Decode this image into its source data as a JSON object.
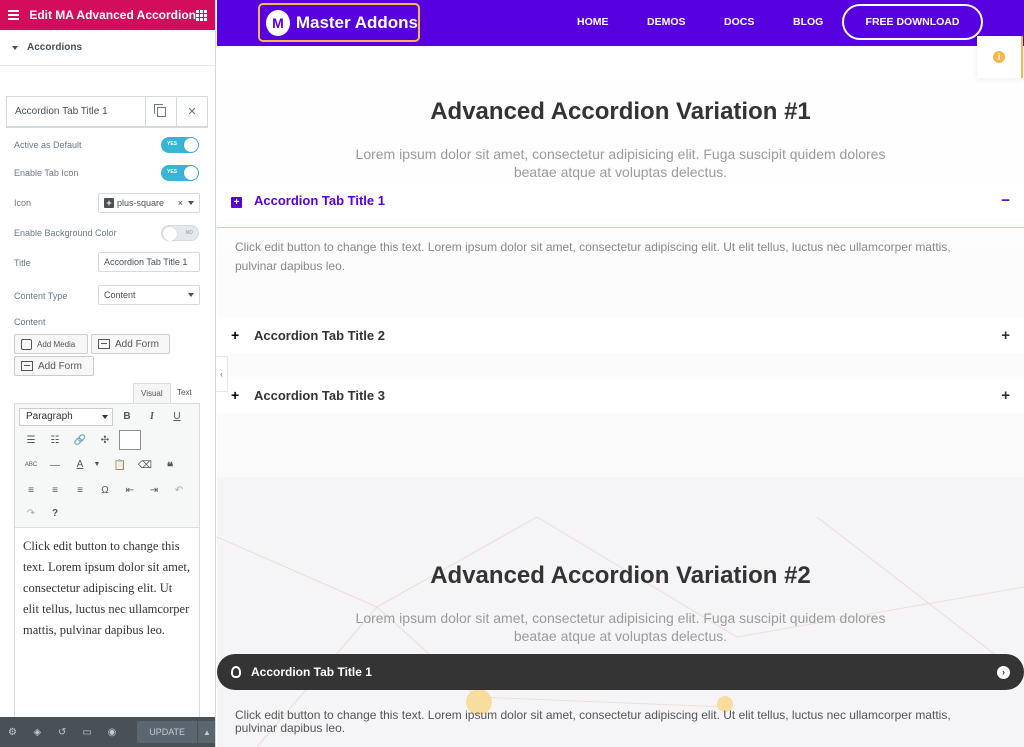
{
  "editor_panel": {
    "title": "Edit MA Advanced Accordion",
    "section": "Accordions",
    "repeater_item": {
      "title": "Accordion Tab Title 1"
    },
    "controls": {
      "active_default": {
        "label": "Active as Default",
        "state": "YES"
      },
      "enable_tab_icon": {
        "label": "Enable Tab Icon",
        "state": "YES"
      },
      "icon": {
        "label": "Icon",
        "value": "plus-square",
        "clear": "×"
      },
      "enable_bg_color": {
        "label": "Enable Background Color",
        "state": "NO"
      },
      "title": {
        "label": "Title",
        "value": "Accordion Tab Title 1"
      },
      "content_type": {
        "label": "Content Type",
        "value": "Content"
      },
      "content": {
        "label": "Content"
      }
    },
    "media_buttons": {
      "add_media": "Add Media",
      "add_form_1": "Add Form",
      "add_form_2": "Add Form"
    },
    "editor_tabs": {
      "visual": "Visual",
      "text": "Text"
    },
    "toolbar": {
      "format": "Paragraph"
    },
    "editor_content": "Click edit button to change this text. Lorem ipsum dolor sit amet, consectetur adipiscing elit. Ut elit tellus, luctus nec ullamcorper mattis, pulvinar dapibus leo.",
    "footer": {
      "update_label": "UPDATE"
    }
  },
  "site": {
    "logo_mark": "M",
    "logo_text": "Master Addons",
    "nav": [
      "HOME",
      "DEMOS",
      "DOCS",
      "BLOG"
    ],
    "cta": "FREE DOWNLOAD",
    "accent": "#5700e0"
  },
  "variation1": {
    "heading": "Advanced Accordion Variation #1",
    "subtitle": "Lorem ipsum dolor sit amet, consectetur adipisicing elit. Fuga suscipit quidem dolores beatae atque at voluptas delectus.",
    "items": [
      {
        "title": "Accordion Tab Title 1",
        "toggle": "−"
      },
      {
        "title": "Accordion Tab Title 2",
        "toggle": "+"
      },
      {
        "title": "Accordion Tab Title 3",
        "toggle": "+"
      }
    ],
    "body": "Click edit button to change this text. Lorem ipsum dolor sit amet, consectetur adipiscing elit. Ut elit tellus, luctus nec ullamcorper mattis, pulvinar dapibus leo."
  },
  "variation2": {
    "heading": "Advanced Accordion Variation #2",
    "subtitle": "Lorem ipsum dolor sit amet, consectetur adipisicing elit. Fuga suscipit quidem dolores beatae atque at voluptas delectus.",
    "item_title": "Accordion Tab Title 1",
    "body": "Click edit button to change this text. Lorem ipsum dolor sit amet, consectetur adipiscing elit. Ut elit tellus, luctus nec ullamcorper mattis, pulvinar dapibus leo."
  }
}
